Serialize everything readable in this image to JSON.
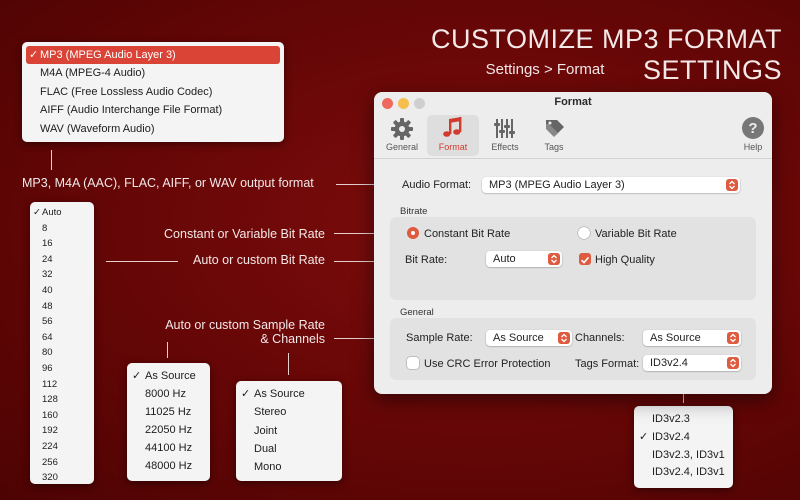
{
  "header": {
    "title": "CUSTOMIZE MP3 FORMAT SETTINGS",
    "breadcrumb": "Settings > Format"
  },
  "annotations": {
    "output_format": "MP3, M4A (AAC), FLAC, AIFF, or WAV output format",
    "bitrate_mode": "Constant or Variable Bit Rate",
    "bitrate_value": "Auto or custom Bit Rate",
    "sample_rate_line1": "Auto or custom Sample Rate",
    "sample_rate_line2": "& Channels"
  },
  "format_menu": {
    "items": [
      {
        "label": "MP3 (MPEG Audio Layer 3)",
        "check": "✓"
      },
      {
        "label": "M4A (MPEG-4 Audio)",
        "check": ""
      },
      {
        "label": "FLAC (Free Lossless Audio Codec)",
        "check": ""
      },
      {
        "label": "AIFF (Audio Interchange File Format)",
        "check": ""
      },
      {
        "label": "WAV (Waveform Audio)",
        "check": ""
      }
    ]
  },
  "bitrate_menu": {
    "items": [
      {
        "label": "Auto",
        "check": "✓"
      },
      {
        "label": "8",
        "check": ""
      },
      {
        "label": "16",
        "check": ""
      },
      {
        "label": "24",
        "check": ""
      },
      {
        "label": "32",
        "check": ""
      },
      {
        "label": "40",
        "check": ""
      },
      {
        "label": "48",
        "check": ""
      },
      {
        "label": "56",
        "check": ""
      },
      {
        "label": "64",
        "check": ""
      },
      {
        "label": "80",
        "check": ""
      },
      {
        "label": "96",
        "check": ""
      },
      {
        "label": "112",
        "check": ""
      },
      {
        "label": "128",
        "check": ""
      },
      {
        "label": "160",
        "check": ""
      },
      {
        "label": "192",
        "check": ""
      },
      {
        "label": "224",
        "check": ""
      },
      {
        "label": "256",
        "check": ""
      },
      {
        "label": "320",
        "check": ""
      }
    ]
  },
  "sample_rate_menu": {
    "items": [
      {
        "label": "As Source",
        "check": "✓"
      },
      {
        "label": "8000 Hz",
        "check": ""
      },
      {
        "label": "11025 Hz",
        "check": ""
      },
      {
        "label": "22050 Hz",
        "check": ""
      },
      {
        "label": "44100 Hz",
        "check": ""
      },
      {
        "label": "48000 Hz",
        "check": ""
      }
    ]
  },
  "channels_menu": {
    "items": [
      {
        "label": "As Source",
        "check": "✓"
      },
      {
        "label": "Stereo",
        "check": ""
      },
      {
        "label": "Joint",
        "check": ""
      },
      {
        "label": "Dual",
        "check": ""
      },
      {
        "label": "Mono",
        "check": ""
      }
    ]
  },
  "tags_menu": {
    "items": [
      {
        "label": "ID3v2.3",
        "check": ""
      },
      {
        "label": "ID3v2.4",
        "check": "✓"
      },
      {
        "label": "ID3v2.3, ID3v1",
        "check": ""
      },
      {
        "label": "ID3v2.4, ID3v1",
        "check": ""
      }
    ]
  },
  "window": {
    "title": "Format",
    "tabs": [
      {
        "label": "General",
        "icon": "gear-icon"
      },
      {
        "label": "Format",
        "icon": "music-note-icon"
      },
      {
        "label": "Effects",
        "icon": "sliders-icon"
      },
      {
        "label": "Tags",
        "icon": "tag-icon"
      },
      {
        "label": "Help",
        "icon": "question-icon"
      }
    ],
    "audio_format": {
      "label": "Audio Format:",
      "value": "MP3 (MPEG Audio Layer 3)"
    },
    "bitrate": {
      "group_label": "Bitrate",
      "constant_label": "Constant Bit Rate",
      "variable_label": "Variable Bit Rate",
      "constant_selected": true,
      "bitrate_label": "Bit Rate:",
      "bitrate_value": "Auto",
      "high_quality_label": "High Quality",
      "high_quality_checked": true
    },
    "general": {
      "group_label": "General",
      "sample_rate_label": "Sample Rate:",
      "sample_rate_value": "As Source",
      "channels_label": "Channels:",
      "channels_value": "As Source",
      "crc_label": "Use CRC Error Protection",
      "crc_checked": false,
      "tags_format_label": "Tags Format:",
      "tags_format_value": "ID3v2.4"
    }
  },
  "colors": {
    "accent": "#d94437",
    "background": "#6a0707",
    "traffic_close": "#ee6a5e",
    "traffic_min": "#f5be4f",
    "traffic_max": "#cfcfcf"
  }
}
